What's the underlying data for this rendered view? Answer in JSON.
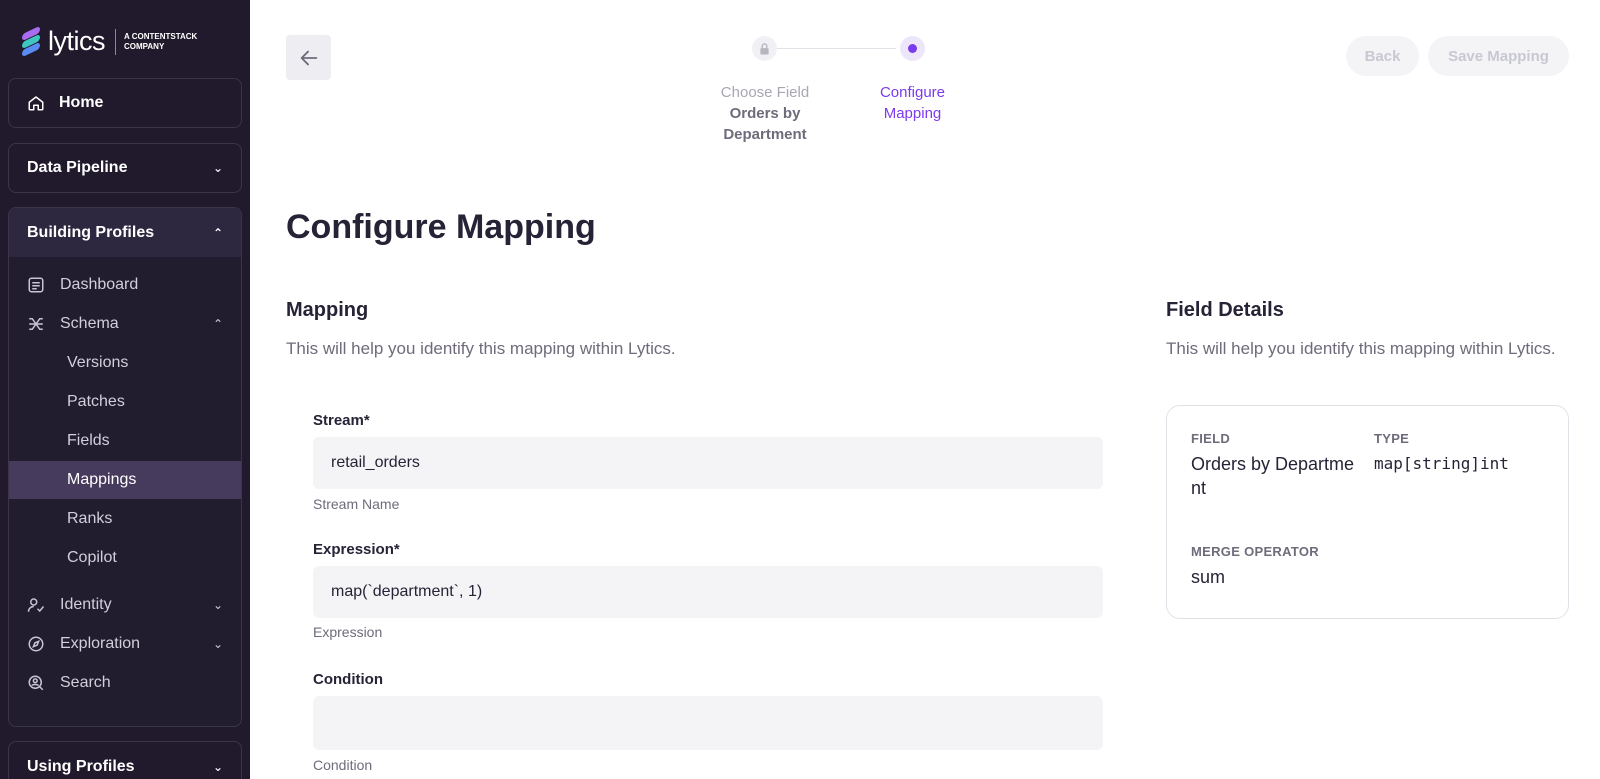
{
  "brand": {
    "name": "lytics",
    "tagline": "A CONTENTSTACK COMPANY",
    "mark_colors": [
      "#a86cf0",
      "#3ec6c0",
      "#5a8cf5"
    ]
  },
  "sidebar": {
    "home": "Home",
    "data_pipeline": "Data Pipeline",
    "building_profiles": "Building Profiles",
    "items": {
      "dashboard": "Dashboard",
      "schema": "Schema",
      "versions": "Versions",
      "patches": "Patches",
      "fields": "Fields",
      "mappings": "Mappings",
      "ranks": "Ranks",
      "copilot": "Copilot",
      "identity": "Identity",
      "exploration": "Exploration",
      "search": "Search"
    },
    "using_profiles": "Using Profiles",
    "active_item": "Mappings"
  },
  "stepper": {
    "step1_title": "Choose Field",
    "step1_value": "Orders by Department",
    "step2_title": "Configure Mapping"
  },
  "actions": {
    "back": "Back",
    "save": "Save Mapping"
  },
  "page": {
    "title": "Configure Mapping"
  },
  "mapping": {
    "title": "Mapping",
    "subtitle": "This will help you identify this mapping within Lytics.",
    "stream_label": "Stream",
    "stream_value": "retail_orders",
    "stream_help": "Stream Name",
    "expression_label": "Expression",
    "expression_value": "map(`department`, 1)",
    "expression_help": "Expression",
    "condition_label": "Condition",
    "condition_value": "",
    "condition_help": "Condition",
    "required_mark": "*"
  },
  "field_details": {
    "title": "Field Details",
    "subtitle": "This will help you identify this mapping within Lytics.",
    "field_label": "FIELD",
    "field_value": "Orders by Departme nt",
    "type_label": "TYPE",
    "type_value": "map[string]int",
    "merge_label": "MERGE OPERATOR",
    "merge_value": "sum"
  },
  "colors": {
    "sidebar_bg": "#201a2c",
    "accent": "#7c3aed",
    "active_item_bg": "#473b5d"
  }
}
